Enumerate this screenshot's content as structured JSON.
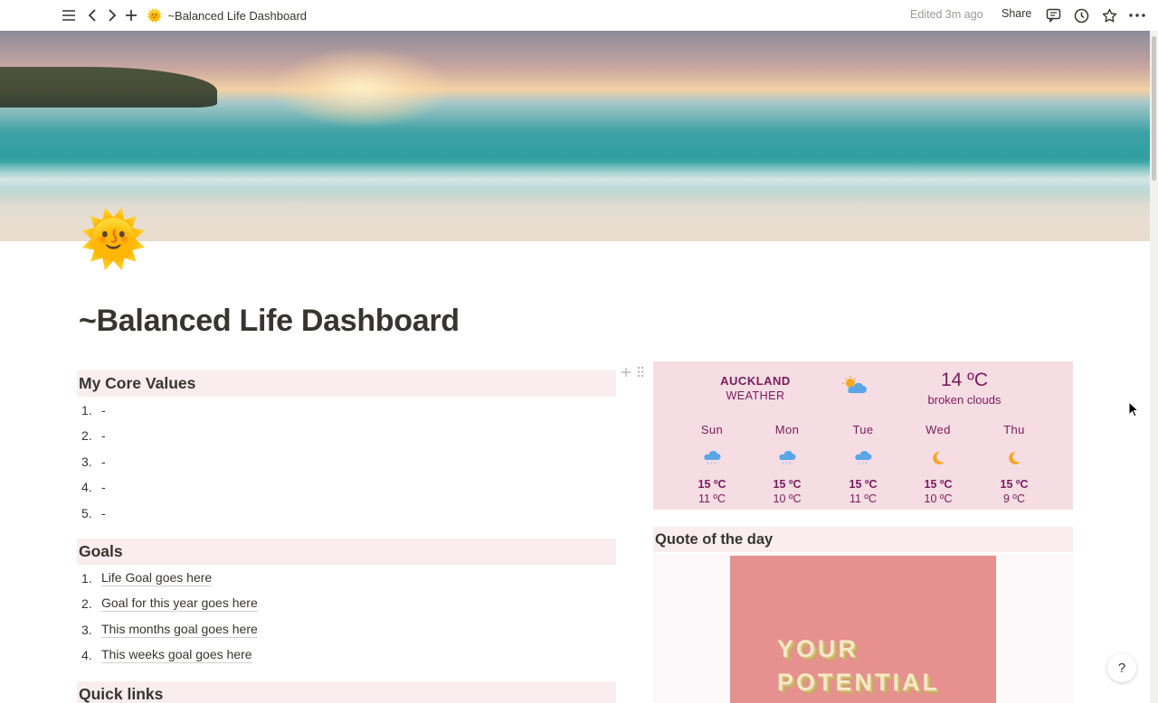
{
  "topbar": {
    "title_emoji": "🌞",
    "title": "~Balanced Life Dashboard",
    "edited": "Edited 3m ago",
    "share_label": "Share"
  },
  "page": {
    "icon_emoji": "🌞",
    "title": "~Balanced Life Dashboard"
  },
  "core_values": {
    "heading": "My Core Values",
    "items": [
      {
        "num": "1.",
        "text": "-"
      },
      {
        "num": "2.",
        "text": "-"
      },
      {
        "num": "3.",
        "text": "-"
      },
      {
        "num": "4.",
        "text": "-"
      },
      {
        "num": "5.",
        "text": "-"
      }
    ]
  },
  "goals": {
    "heading": "Goals",
    "items": [
      {
        "num": "1.",
        "text": "Life Goal goes here"
      },
      {
        "num": "2.",
        "text": "Goal for this year goes here"
      },
      {
        "num": "3.",
        "text": "This months goal goes here"
      },
      {
        "num": "4.",
        "text": "This weeks goal goes here"
      }
    ]
  },
  "quick_links": {
    "heading": "Quick links"
  },
  "weather": {
    "city": "AUCKLAND",
    "label": "WEATHER",
    "current_icon": "sun-behind-cloud-icon",
    "temp": "14 ºC",
    "description": "broken clouds",
    "forecast": [
      {
        "day": "Sun",
        "icon": "rain-cloud-icon",
        "hi": "15 ºC",
        "lo": "11 ºC"
      },
      {
        "day": "Mon",
        "icon": "rain-cloud-icon",
        "hi": "15 ºC",
        "lo": "10 ºC"
      },
      {
        "day": "Tue",
        "icon": "rain-cloud-icon",
        "hi": "15 ºC",
        "lo": "11 ºC"
      },
      {
        "day": "Wed",
        "icon": "crescent-moon-icon",
        "hi": "15 ºC",
        "lo": "10 ºC"
      },
      {
        "day": "Thu",
        "icon": "crescent-moon-icon",
        "hi": "15 ºC",
        "lo": "9 ºC"
      }
    ]
  },
  "quote": {
    "heading": "Quote of the day",
    "image_lines": [
      "YOUR",
      "POTENTIAL"
    ]
  },
  "help": {
    "label": "?"
  },
  "colors": {
    "section_bg": "#f9edf0",
    "weather_bg": "#f5dde3",
    "weather_text": "#7a1a5a",
    "quote_image_bg": "#e6918f"
  }
}
